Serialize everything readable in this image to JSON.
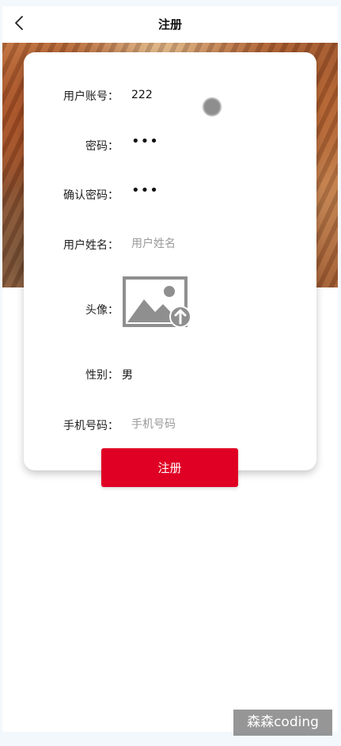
{
  "header": {
    "title": "注册",
    "back_icon": "chevron-left-icon"
  },
  "form": {
    "account": {
      "label": "用户账号：",
      "value": "222"
    },
    "password": {
      "label": "密码：",
      "value": "•••"
    },
    "confirm_password": {
      "label": "确认密码：",
      "value": "•••"
    },
    "name": {
      "label": "用户姓名：",
      "placeholder": "用户姓名",
      "value": ""
    },
    "avatar": {
      "label": "头像：",
      "icon": "image-upload-icon"
    },
    "gender": {
      "label": "性别：",
      "value": "男"
    },
    "phone": {
      "label": "手机号码：",
      "placeholder": "手机号码",
      "value": ""
    }
  },
  "submit_label": "注册",
  "watermark": "森森coding",
  "colors": {
    "primary": "#df0024",
    "background": "#f3f8fc"
  }
}
